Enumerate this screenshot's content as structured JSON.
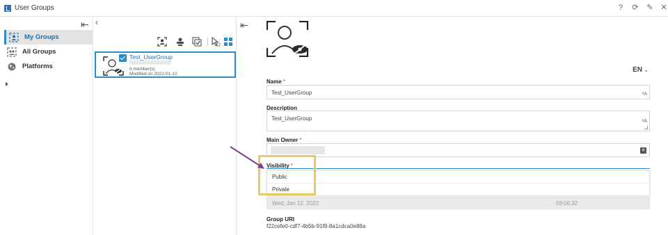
{
  "window": {
    "title": "User Groups",
    "controls": [
      "?",
      "⟳",
      "✎",
      "✕"
    ]
  },
  "sidebar": {
    "items": [
      {
        "label": "My Groups",
        "active": true
      },
      {
        "label": "All Groups",
        "active": false
      },
      {
        "label": "Platforms",
        "active": false
      }
    ]
  },
  "list": {
    "card": {
      "name": "Test_UserGroup",
      "members": "0 member(s)",
      "modified": "Modified on 2022-01-12"
    }
  },
  "detail": {
    "language": "EN",
    "name": {
      "label": "Name",
      "required": "*",
      "value": "Test_UserGroup"
    },
    "description": {
      "label": "Description",
      "value": "Test_UserGroup"
    },
    "owner": {
      "label": "Main Owner",
      "required": "*"
    },
    "visibility": {
      "label": "Visibility",
      "required": "*",
      "options": [
        "Public",
        "Private"
      ]
    },
    "date": {
      "value": "Wed, Jan 12, 2022",
      "time": "09:06:32"
    },
    "uri": {
      "label": "Group URI",
      "value": "f22cefe0-cdf7-4b5b-91f8-8a1cdca0e88a"
    }
  },
  "colors": {
    "accent": "#2d8bc7",
    "highlight": "#e8c864",
    "annotation_arrow": "#7b3f99",
    "required": "#d9342b"
  }
}
